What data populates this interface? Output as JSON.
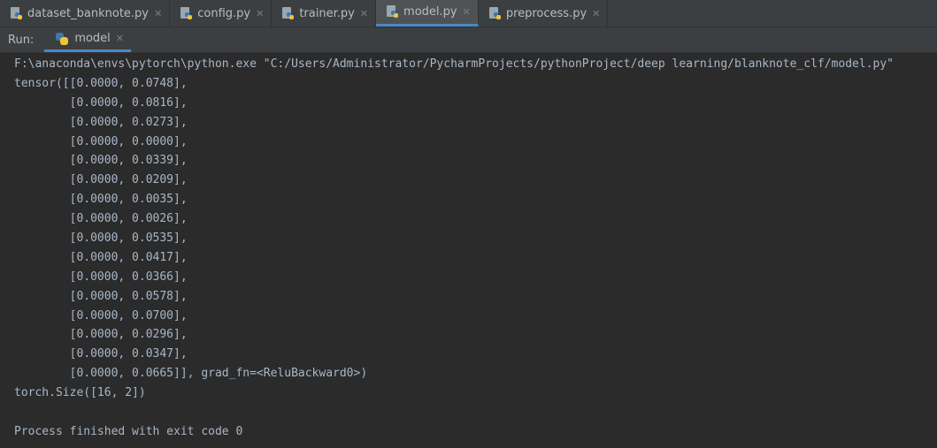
{
  "editor_tabs": [
    {
      "label": "dataset_banknote.py",
      "icon": "python-file-icon",
      "active": false
    },
    {
      "label": "config.py",
      "icon": "python-file-icon",
      "active": false
    },
    {
      "label": "trainer.py",
      "icon": "python-file-icon",
      "active": false
    },
    {
      "label": "model.py",
      "icon": "python-file-icon",
      "active": true
    },
    {
      "label": "preprocess.py",
      "icon": "python-file-icon",
      "active": false
    }
  ],
  "close_glyph": "✕",
  "run_panel": {
    "label": "Run:",
    "tab_label": "model",
    "icon": "python-logo-icon"
  },
  "console": {
    "lines": [
      "F:\\anaconda\\envs\\pytorch\\python.exe \"C:/Users/Administrator/PycharmProjects/pythonProject/deep learning/blanknote_clf/model.py\"",
      "tensor([[0.0000, 0.0748],",
      "        [0.0000, 0.0816],",
      "        [0.0000, 0.0273],",
      "        [0.0000, 0.0000],",
      "        [0.0000, 0.0339],",
      "        [0.0000, 0.0209],",
      "        [0.0000, 0.0035],",
      "        [0.0000, 0.0026],",
      "        [0.0000, 0.0535],",
      "        [0.0000, 0.0417],",
      "        [0.0000, 0.0366],",
      "        [0.0000, 0.0578],",
      "        [0.0000, 0.0700],",
      "        [0.0000, 0.0296],",
      "        [0.0000, 0.0347],",
      "        [0.0000, 0.0665]], grad_fn=<ReluBackward0>)",
      "torch.Size([16, 2])",
      "",
      "Process finished with exit code 0"
    ]
  },
  "colors": {
    "background": "#2b2b2b",
    "panel": "#3c3f41",
    "text": "#a9b7c6",
    "accent": "#4a88c7"
  }
}
